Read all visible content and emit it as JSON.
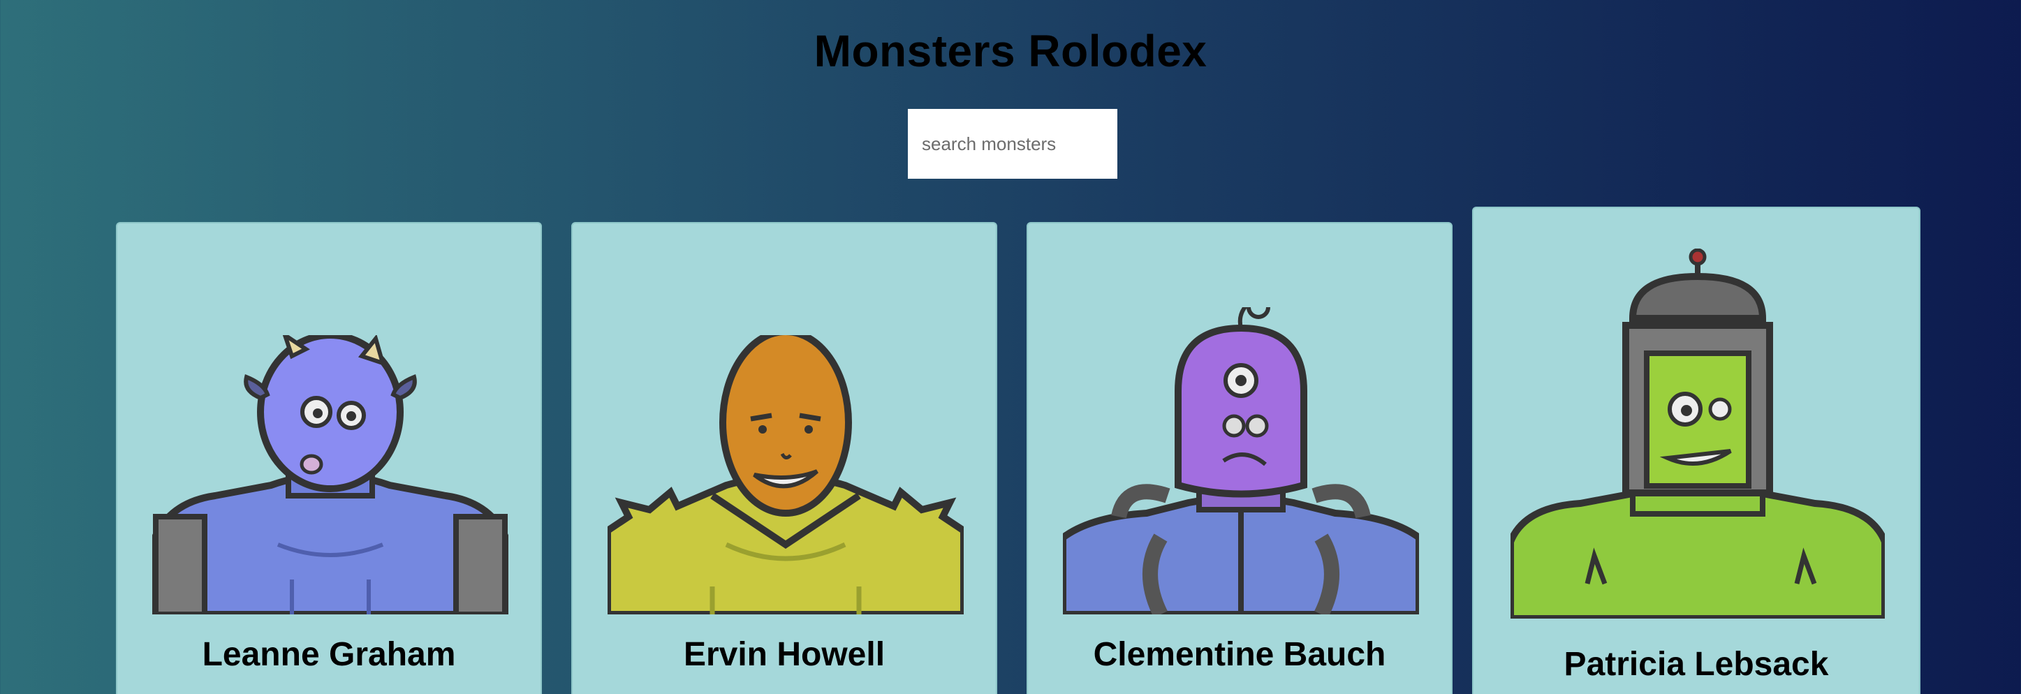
{
  "header": {
    "title": "Monsters Rolodex"
  },
  "search": {
    "placeholder": "search monsters",
    "value": ""
  },
  "monsters": [
    {
      "name": "Leanne Graham"
    },
    {
      "name": "Ervin Howell"
    },
    {
      "name": "Clementine Bauch"
    },
    {
      "name": "Patricia Lebsack"
    }
  ],
  "colors": {
    "card_background": "#a5d8da",
    "gradient_left": "#2e6f7a",
    "gradient_right": "#0d1b4f"
  }
}
